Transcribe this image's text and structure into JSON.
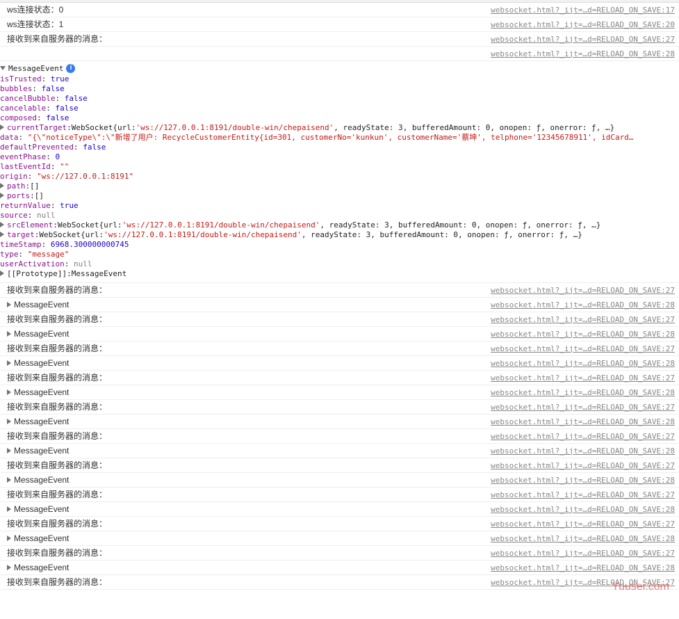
{
  "topRows": [
    {
      "msg": "ws连接状态：0",
      "src": "websocket.html?_ijt=…d=RELOAD_ON_SAVE:17"
    },
    {
      "msg": "ws连接状态：1",
      "src": "websocket.html?_ijt=…d=RELOAD_ON_SAVE:20"
    },
    {
      "msg": "接收到来自服务器的消息：",
      "src": "websocket.html?_ijt=…d=RELOAD_ON_SAVE:27"
    },
    {
      "msg": "",
      "src": "websocket.html?_ijt=…d=RELOAD_ON_SAVE:28"
    }
  ],
  "expanded": {
    "header": "MessageEvent",
    "isTrusted": {
      "k": "isTrusted",
      "v": "true"
    },
    "bubbles": {
      "k": "bubbles",
      "v": "false"
    },
    "cancelBubble": {
      "k": "cancelBubble",
      "v": "false"
    },
    "cancelable": {
      "k": "cancelable",
      "v": "false"
    },
    "composed": {
      "k": "composed",
      "v": "false"
    },
    "currentTarget": {
      "k": "currentTarget",
      "cls": "WebSocket",
      "url": "'ws://127.0.0.1:8191/double-win/chepaisend'",
      "rest": ", readyState: 3, bufferedAmount: 0, onopen: ƒ, onerror: ƒ, …}"
    },
    "data": {
      "k": "data",
      "v": "\"{\\\"noticeType\\\":\\\"新增了用户: RecycleCustomerEntity{id=301, customerNo='kunkun', customerName='蔡坤', telphone='12345678911', idCard…"
    },
    "defaultPrevented": {
      "k": "defaultPrevented",
      "v": "false"
    },
    "eventPhase": {
      "k": "eventPhase",
      "v": "0"
    },
    "lastEventId": {
      "k": "lastEventId",
      "v": "\"\""
    },
    "origin": {
      "k": "origin",
      "v": "\"ws://127.0.0.1:8191\""
    },
    "path": {
      "k": "path",
      "v": "[]"
    },
    "ports": {
      "k": "ports",
      "v": "[]"
    },
    "returnValue": {
      "k": "returnValue",
      "v": "true"
    },
    "source": {
      "k": "source",
      "v": "null"
    },
    "srcElement": {
      "k": "srcElement",
      "cls": "WebSocket",
      "url": "'ws://127.0.0.1:8191/double-win/chepaisend'",
      "rest": ", readyState: 3, bufferedAmount: 0, onopen: ƒ, onerror: ƒ, …}"
    },
    "target": {
      "k": "target",
      "cls": "WebSocket",
      "url": "'ws://127.0.0.1:8191/double-win/chepaisend'",
      "rest": ", readyState: 3, bufferedAmount: 0, onopen: ƒ, onerror: ƒ, …}"
    },
    "timeStamp": {
      "k": "timeStamp",
      "v": "6968.300000000745"
    },
    "type": {
      "k": "type",
      "v": "\"message\""
    },
    "userActivation": {
      "k": "userActivation",
      "v": "null"
    },
    "proto": {
      "k": "[[Prototype]]",
      "v": "MessageEvent"
    }
  },
  "repeat": {
    "msg1": "接收到来自服务器的消息：",
    "msg2": "MessageEvent",
    "src1": "websocket.html?_ijt=…d=RELOAD_ON_SAVE:27",
    "src2": "websocket.html?_ijt=…d=RELOAD_ON_SAVE:28"
  },
  "repeatCount": 10,
  "watermark": "Yuusei.com"
}
